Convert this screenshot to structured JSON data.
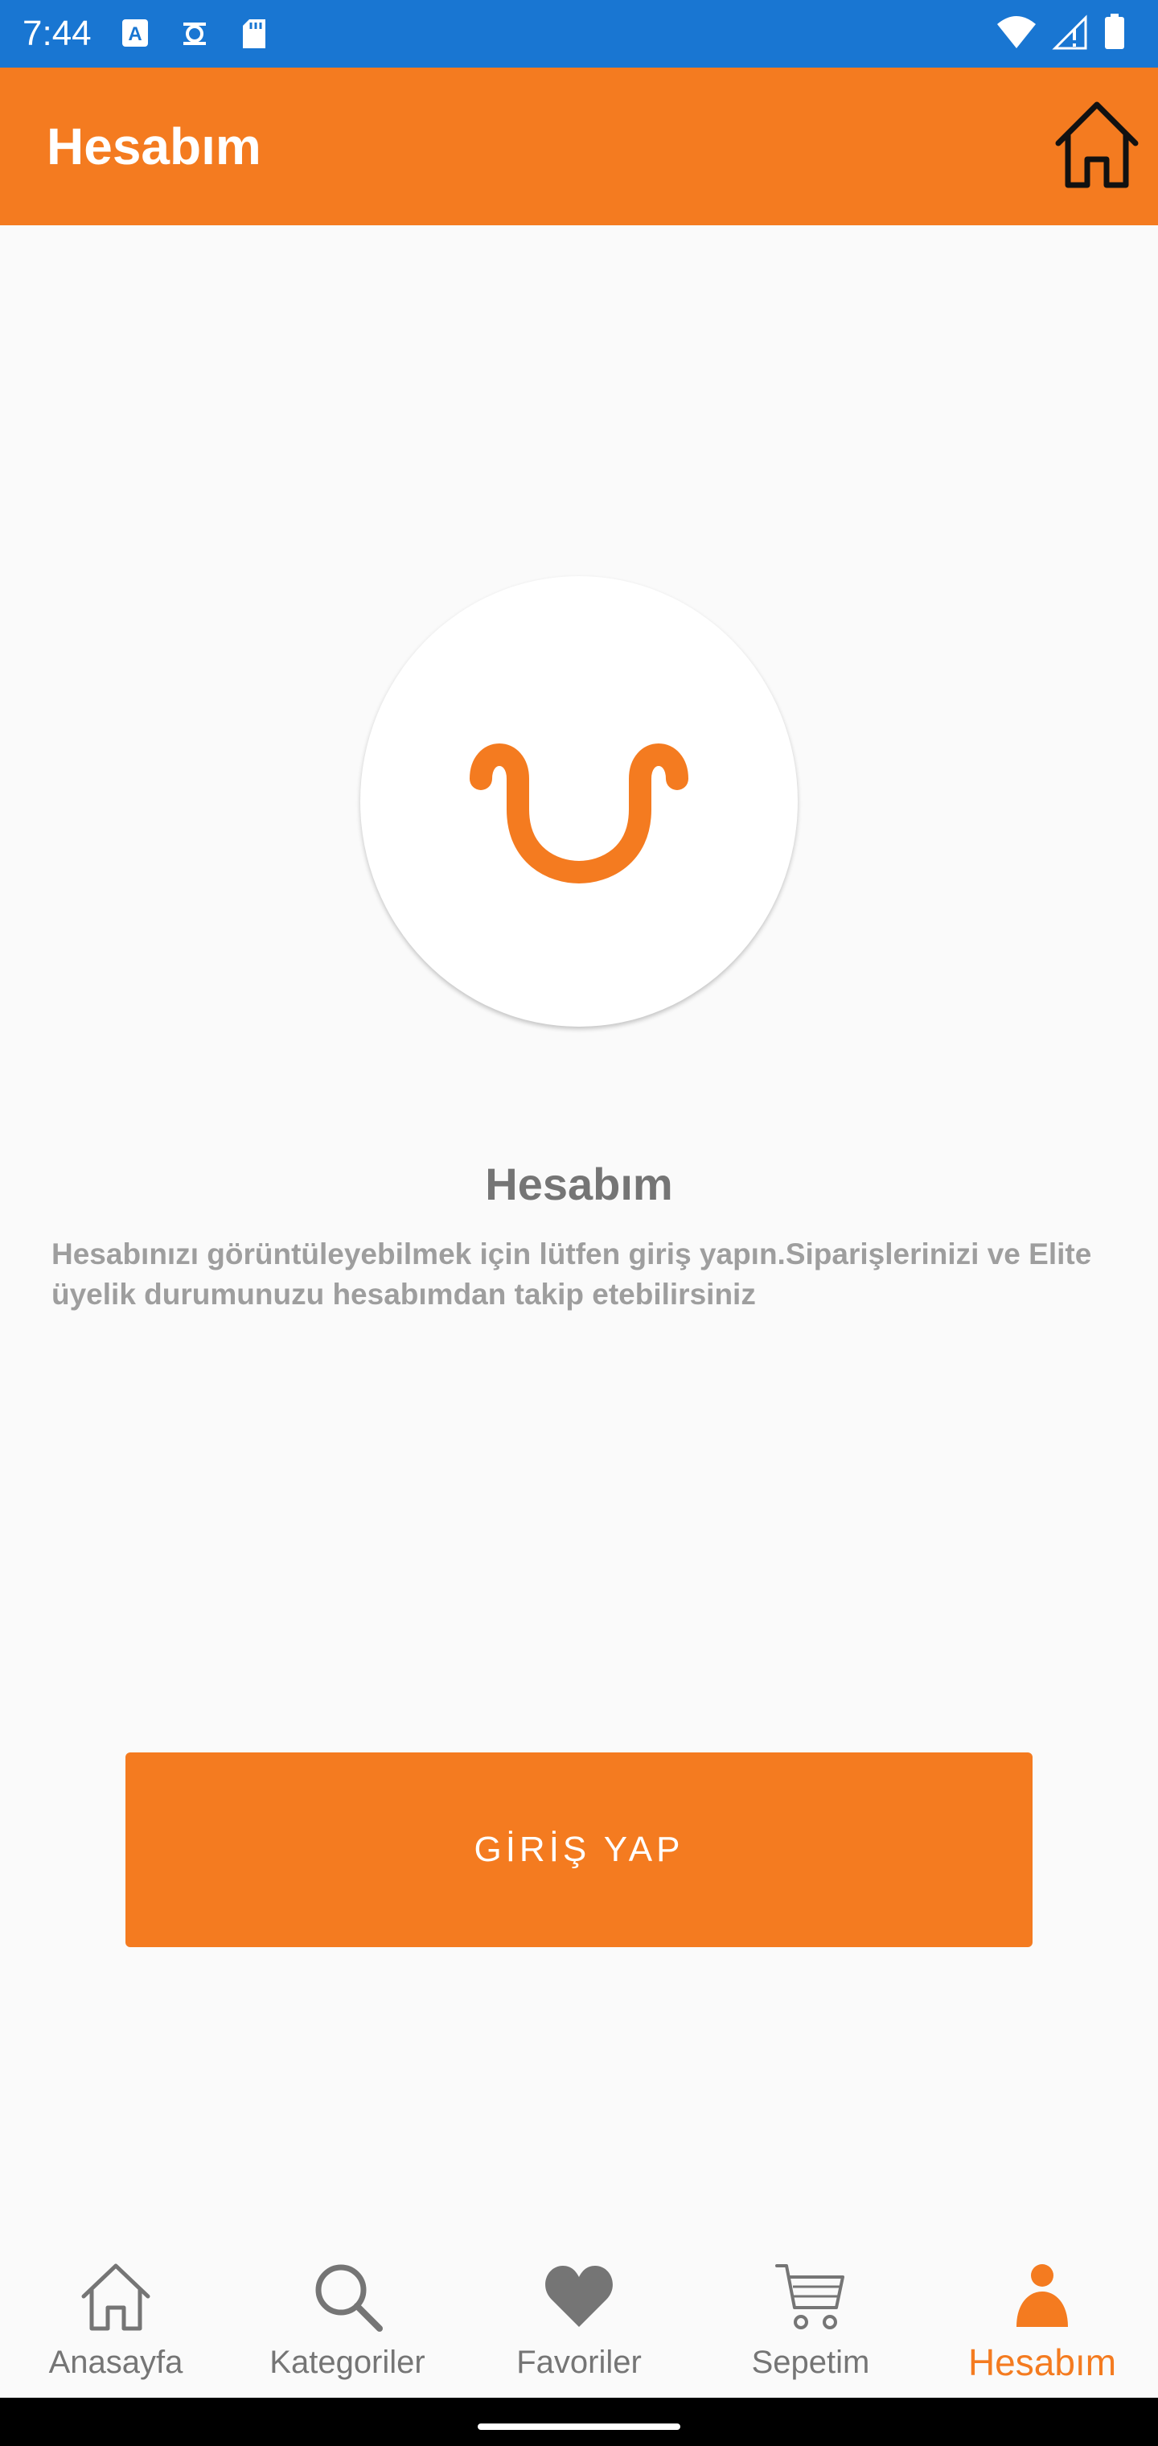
{
  "status_bar": {
    "time": "7:44",
    "left_icons": [
      "keyboard-a-icon",
      "screen-record-icon",
      "sd-card-icon"
    ],
    "right_icons": [
      "wifi-icon",
      "signal-icon",
      "battery-icon"
    ],
    "background_color": "#1976d2"
  },
  "app_bar": {
    "title": "Hesabım",
    "home_icon": "home-outline-icon",
    "background_color": "#f47b20"
  },
  "main": {
    "avatar_icon": "smile-logo-icon",
    "title": "Hesabım",
    "description": "Hesabınızı görüntüleyebilmek için lütfen giriş yapın.Siparişlerinizi ve Elite üyelik durumunuzu hesabımdan takip etebilirsiniz",
    "login_button_label": "GİRİŞ YAP"
  },
  "bottom_nav": {
    "active_index": 4,
    "active_color": "#f47b20",
    "items": [
      {
        "label": "Anasayfa",
        "icon": "home-icon"
      },
      {
        "label": "Kategoriler",
        "icon": "search-icon"
      },
      {
        "label": "Favoriler",
        "icon": "heart-icon"
      },
      {
        "label": "Sepetim",
        "icon": "cart-icon"
      },
      {
        "label": "Hesabım",
        "icon": "person-icon"
      }
    ]
  }
}
